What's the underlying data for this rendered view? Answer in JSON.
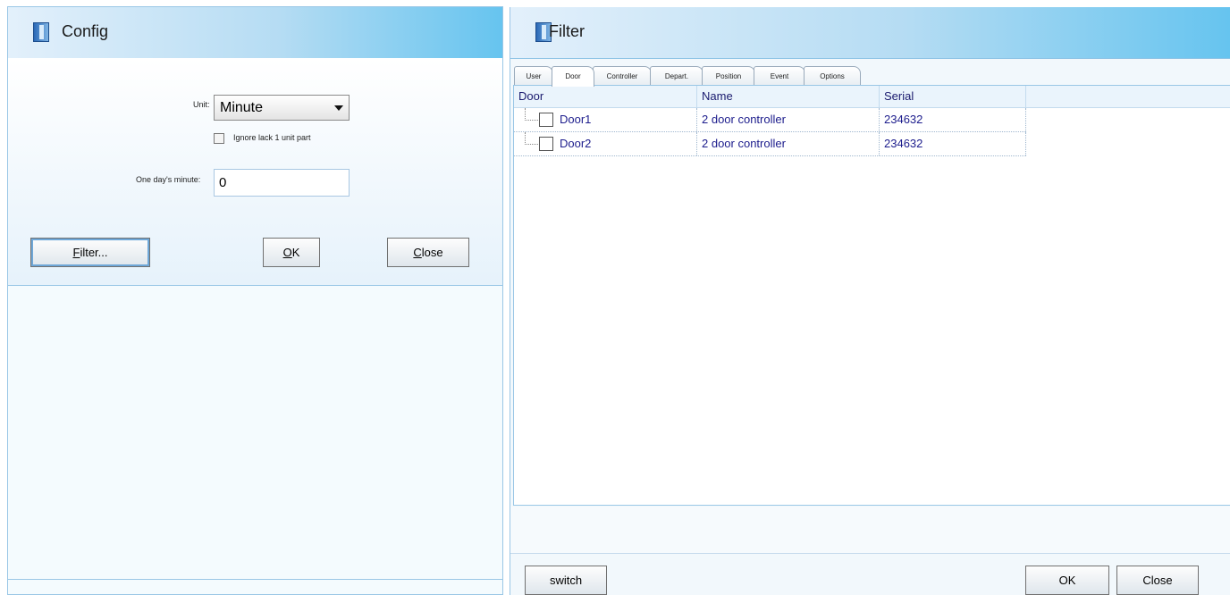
{
  "config": {
    "title": "Config",
    "unit_label": "Unit:",
    "unit_value": "Minute",
    "ignore_label": "Ignore lack 1 unit part",
    "ignore_checked": false,
    "one_day_label": "One day's minute:",
    "one_day_value": "0",
    "buttons": {
      "filter": {
        "u": "F",
        "rest": "ilter..."
      },
      "ok": {
        "u": "O",
        "rest": "K"
      },
      "close": {
        "u": "C",
        "rest": "lose"
      }
    }
  },
  "filter": {
    "title": "Filter",
    "tabs": [
      "User",
      "Door",
      "Controller",
      "Depart.",
      "Position",
      "Event",
      "Options"
    ],
    "active_tab": "Door",
    "columns": [
      "Door",
      "Name",
      "Serial"
    ],
    "rows": [
      {
        "door": "Door1",
        "name": "2 door controller",
        "serial": "234632",
        "checked": false
      },
      {
        "door": "Door2",
        "name": "2 door controller",
        "serial": "234632",
        "checked": false
      }
    ],
    "buttons": {
      "switch": "switch",
      "ok": "OK",
      "close": "Close"
    }
  },
  "colors": {
    "titlebar_accent": "#66c4ef",
    "grid_text": "#1c1c8c",
    "border": "#9ac7e6"
  }
}
